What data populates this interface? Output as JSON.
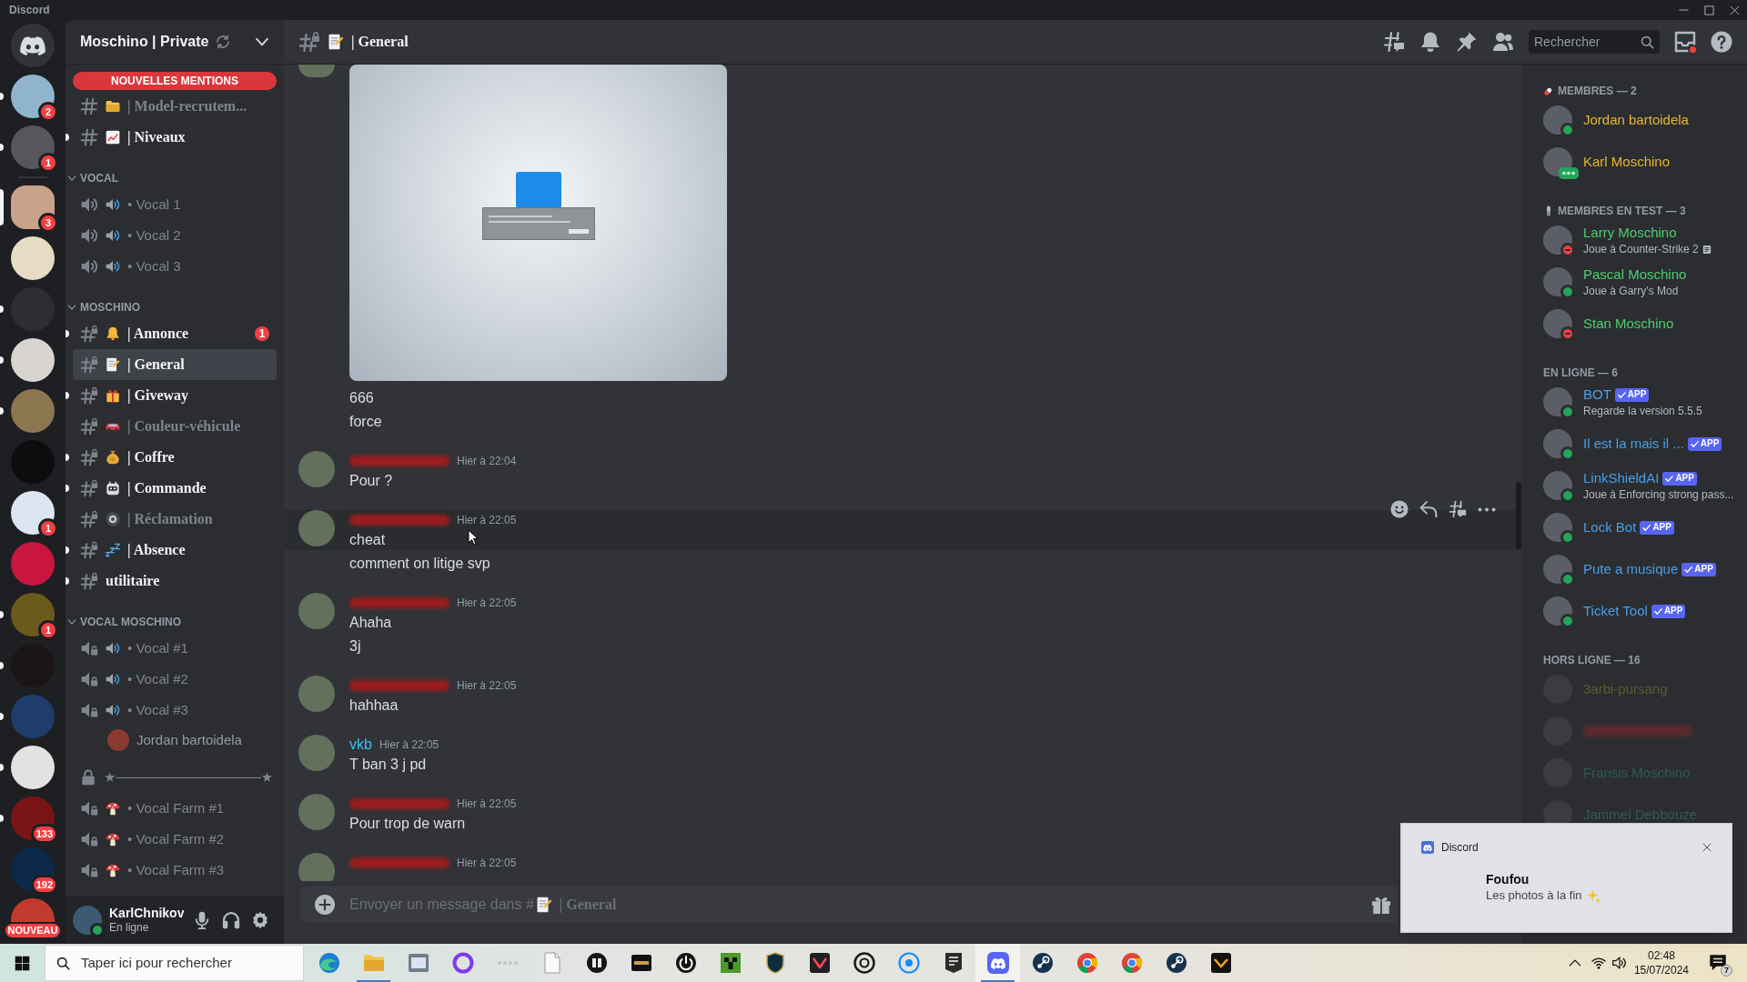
{
  "title_bar": {
    "title": "Discord"
  },
  "server_rail": {
    "home": {
      "selected": false
    },
    "direct_messages": [
      {
        "color": "#8fb4cc",
        "selected": false,
        "unread": true,
        "badge": "2"
      },
      {
        "color": "#55575b",
        "selected": false,
        "unread": true,
        "badge": "1"
      }
    ],
    "servers": [
      {
        "color": "#c9a28a",
        "selected": true,
        "badge": "3"
      },
      {
        "color": "#e6dcc4",
        "selected": false,
        "unread": false
      },
      {
        "color": "#2c2e33",
        "selected": false,
        "unread": true
      },
      {
        "color": "#d9d4cf",
        "selected": false,
        "unread": true
      },
      {
        "color": "#8c7650",
        "selected": false,
        "unread": true
      },
      {
        "color": "#0d0d0f",
        "selected": false,
        "unread": false
      },
      {
        "color": "#dde6f0",
        "selected": false,
        "unread": false,
        "badge": "1"
      },
      {
        "color": "#c8163f",
        "selected": false,
        "unread": false
      },
      {
        "color": "#6a5a1c",
        "selected": false,
        "unread": true,
        "badge": "1"
      },
      {
        "color": "#1b1515",
        "selected": false,
        "unread": true
      },
      {
        "color": "#1f3d6b",
        "selected": false,
        "unread": true
      },
      {
        "color": "#e4e1e1",
        "selected": false,
        "unread": true
      },
      {
        "color": "#7a1414",
        "selected": false,
        "unread": true,
        "badge": "133"
      },
      {
        "color": "#0c2a48",
        "selected": false,
        "unread": false,
        "badge": "192"
      },
      {
        "color": "#c23a2c",
        "selected": false,
        "unread": false,
        "badge": "NOUVEAU"
      }
    ]
  },
  "channel_sidebar": {
    "server_name": "Moschino | Private",
    "new_mentions": "NOUVELLES MENTIONS",
    "sections": [
      {
        "channels": [
          {
            "kind": "text",
            "private": false,
            "name": "| Model-recrutem...",
            "unread": false,
            "selected": false
          },
          {
            "kind": "text",
            "private": false,
            "name": "| Niveaux",
            "unread": true,
            "selected": false
          }
        ]
      },
      {
        "category": "VOCAL",
        "expanded": true,
        "channels": [
          {
            "kind": "voice",
            "private": false,
            "name": "• Vocal 1",
            "unread": false,
            "selected": false
          },
          {
            "kind": "voice",
            "private": false,
            "name": "• Vocal 2",
            "unread": false,
            "selected": false
          },
          {
            "kind": "voice",
            "private": false,
            "name": "• Vocal 3",
            "unread": false,
            "selected": false
          }
        ]
      },
      {
        "category": "MOSCHINO",
        "expanded": true,
        "channels": [
          {
            "kind": "text",
            "private": true,
            "name": "| Annonce",
            "unread": true,
            "selected": false,
            "badge": "1"
          },
          {
            "kind": "text",
            "private": true,
            "name": "| General",
            "unread": false,
            "selected": true
          },
          {
            "kind": "text",
            "private": true,
            "name": "| Giveway",
            "unread": true,
            "selected": false
          },
          {
            "kind": "text",
            "private": true,
            "name": "| Couleur-véhicule",
            "unread": false,
            "selected": false
          },
          {
            "kind": "text",
            "private": true,
            "name": "| Coffre",
            "unread": true,
            "selected": false
          },
          {
            "kind": "text",
            "private": true,
            "name": "| Commande",
            "unread": true,
            "selected": false
          },
          {
            "kind": "text",
            "private": true,
            "name": "| Réclamation",
            "unread": false,
            "selected": false
          },
          {
            "kind": "text",
            "private": true,
            "name": "| Absence",
            "unread": true,
            "selected": false
          },
          {
            "kind": "text",
            "private": true,
            "name": "utilitaire",
            "unread": true,
            "selected": false
          }
        ]
      },
      {
        "category": "VOCAL MOSCHINO",
        "expanded": true,
        "channels": [
          {
            "kind": "voice",
            "private": true,
            "name": "• Vocal #1",
            "unread": false,
            "selected": false
          },
          {
            "kind": "voice",
            "private": true,
            "name": "• Vocal #2",
            "unread": false,
            "selected": false
          },
          {
            "kind": "voice",
            "private": true,
            "name": "• Vocal #3",
            "unread": false,
            "selected": false,
            "users": [
              {
                "name": "Jordan bartoidela"
              }
            ]
          },
          {
            "kind": "locked",
            "name": "★───────────────★",
            "unread": false,
            "selected": false
          },
          {
            "kind": "voice",
            "private": true,
            "name": "• Vocal Farm #1",
            "unread": false,
            "selected": false
          },
          {
            "kind": "voice",
            "private": true,
            "name": "• Vocal Farm #2",
            "unread": false,
            "selected": false
          },
          {
            "kind": "voice",
            "private": true,
            "name": "• Vocal Farm #3",
            "unread": false,
            "selected": false
          }
        ]
      }
    ]
  },
  "user_panel": {
    "username": "KarlChnikov",
    "status_text": "En ligne",
    "presence": {
      "kind": "dot",
      "color": "#23a55a"
    }
  },
  "chat_header": {
    "channel_name": "| General",
    "search_placeholder": "Rechercher",
    "inbox_unread": true
  },
  "messages": [
    {
      "kind": "cut",
      "image": true,
      "hovered": false,
      "lines": [
        "666",
        "force"
      ]
    },
    {
      "kind": "full",
      "author_blurred": true,
      "color": "#9b1c1c",
      "time": "Hier à 22:04",
      "hovered": false,
      "lines": [
        "Pour ?"
      ]
    },
    {
      "kind": "full",
      "author_blurred": true,
      "color": "#9b1c1c",
      "time": "Hier à 22:05",
      "hovered": true,
      "lines": [
        "cheat",
        "comment on litige svp"
      ]
    },
    {
      "kind": "full",
      "author_blurred": true,
      "color": "#9b1c1c",
      "time": "Hier à 22:05",
      "hovered": false,
      "lines": [
        "Ahaha",
        "3j"
      ]
    },
    {
      "kind": "full",
      "author_blurred": true,
      "color": "#9b1c1c",
      "time": "Hier à 22:05",
      "hovered": false,
      "lines": [
        "hahhaa"
      ]
    },
    {
      "kind": "full",
      "author_blurred": false,
      "author": "vkb",
      "color": "#33c3f0",
      "time": "Hier à 22:05",
      "hovered": false,
      "lines": [
        "T ban 3 j pd"
      ]
    },
    {
      "kind": "full",
      "author_blurred": true,
      "color": "#9b1c1c",
      "time": "Hier à 22:05",
      "hovered": false,
      "lines": [
        "Pour trop de warn"
      ]
    },
    {
      "kind": "full",
      "author_blurred": true,
      "color": "#9b1c1c",
      "time": "Hier à 22:05",
      "hovered": false
    }
  ],
  "message_input": {
    "placeholder": "Envoyer un message dans #",
    "channel_name": "| General"
  },
  "member_list": {
    "groups": [
      {
        "title": "MEMBRES — 2",
        "members": [
          {
            "name": "Jordan bartoidela",
            "blurred": false,
            "offline": false,
            "color": "#e8b52e",
            "presence": {
              "kind": "dot",
              "color": "#23a55a"
            }
          },
          {
            "name": "Karl Moschino",
            "blurred": false,
            "offline": false,
            "color": "#e8b52e",
            "presence": {
              "kind": "phone",
              "color": "#23a55a"
            }
          }
        ]
      },
      {
        "title": "MEMBRES EN TEST — 3",
        "members": [
          {
            "name": "Larry Moschino",
            "blurred": false,
            "offline": false,
            "color": "#4dcf6f",
            "presence": {
              "kind": "dnd",
              "color": "#f23f43"
            },
            "activity": "Joue à Counter-Strike 2",
            "rich_presence": true
          },
          {
            "name": "Pascal Moschino",
            "blurred": false,
            "offline": false,
            "color": "#4dcf6f",
            "presence": {
              "kind": "dot",
              "color": "#23a55a"
            },
            "activity": "Joue à Garry's Mod",
            "rich_presence": false
          },
          {
            "name": "Stan Moschino",
            "blurred": false,
            "offline": false,
            "color": "#4dcf6f",
            "presence": {
              "kind": "dnd",
              "color": "#f23f43"
            }
          }
        ]
      },
      {
        "title": "EN LIGNE — 6",
        "members": [
          {
            "name": "BOT",
            "blurred": false,
            "offline": false,
            "color": "#4a9fe8",
            "presence": {
              "kind": "dot",
              "color": "#23a55a"
            },
            "badge": "APP",
            "activity": "Regarde la version 5.5.5",
            "rich_presence": false
          },
          {
            "name": "Il est la mais il ...",
            "blurred": false,
            "offline": false,
            "color": "#4a9fe8",
            "presence": {
              "kind": "dot",
              "color": "#23a55a"
            },
            "badge": "APP"
          },
          {
            "name": "LinkShieldAI",
            "blurred": false,
            "offline": false,
            "color": "#4a9fe8",
            "presence": {
              "kind": "dot",
              "color": "#23a55a"
            },
            "badge": "APP",
            "activity": "Joue à Enforcing strong pass...",
            "rich_presence": false
          },
          {
            "name": "Lock Bot",
            "blurred": false,
            "offline": false,
            "color": "#4a9fe8",
            "presence": {
              "kind": "dot",
              "color": "#23a55a"
            },
            "badge": "APP"
          },
          {
            "name": "Pute a musique",
            "blurred": false,
            "offline": false,
            "color": "#4a9fe8",
            "presence": {
              "kind": "dot",
              "color": "#23a55a"
            },
            "badge": "APP"
          },
          {
            "name": "Ticket Tool",
            "blurred": false,
            "offline": false,
            "color": "#4a9fe8",
            "presence": {
              "kind": "dot",
              "color": "#23a55a"
            },
            "badge": "APP"
          }
        ]
      },
      {
        "title": "HORS LIGNE — 16",
        "members": [
          {
            "name": "3arbi-pursang",
            "blurred": false,
            "offline": true,
            "color": "#615a2a"
          },
          {
            "blurred": true,
            "offline": true,
            "color": "#5c2a2c"
          },
          {
            "name": "Fransis Moschino",
            "blurred": false,
            "offline": true,
            "color": "#2e5b56"
          },
          {
            "name": "Jammel Debbouze",
            "blurred": false,
            "offline": true,
            "color": "#2e5b56"
          }
        ]
      }
    ]
  },
  "notification": {
    "app": "Discord",
    "title": "Foufou",
    "message": "Les photos à la fin"
  },
  "taskbar": {
    "search_placeholder": "Taper ici pour rechercher",
    "apps": [
      {
        "active": false,
        "running": false
      },
      {
        "active": false,
        "running": true
      },
      {
        "active": false,
        "running": false
      },
      {
        "active": false,
        "running": false
      },
      {
        "active": false,
        "running": false
      },
      {
        "active": false,
        "running": false
      },
      {
        "active": false,
        "running": false
      },
      {
        "active": false,
        "running": false
      },
      {
        "active": false,
        "running": false
      },
      {
        "active": false,
        "running": false
      },
      {
        "active": false,
        "running": false
      },
      {
        "active": false,
        "running": false
      },
      {
        "active": false,
        "running": false
      },
      {
        "active": false,
        "running": false
      },
      {
        "active": false,
        "running": false
      },
      {
        "active": true,
        "running": true
      },
      {
        "active": false,
        "running": false
      },
      {
        "active": false,
        "running": false
      },
      {
        "active": false,
        "running": false
      },
      {
        "active": false,
        "running": false
      },
      {
        "active": false,
        "running": false
      }
    ],
    "time": "02:48",
    "date": "15/07/2024",
    "notification_count": "7"
  }
}
